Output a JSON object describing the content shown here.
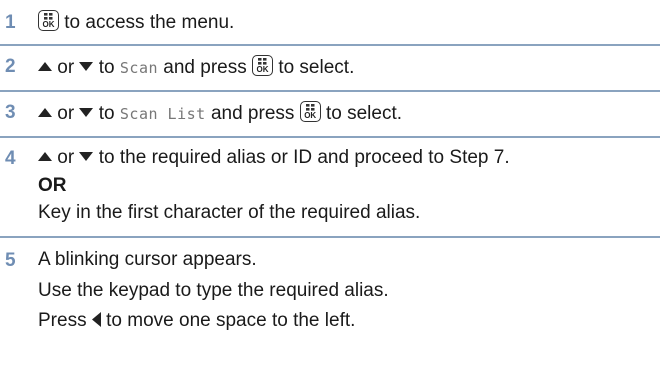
{
  "steps": [
    {
      "number": "1",
      "text_a": "to access the menu."
    },
    {
      "number": "2",
      "or": "or",
      "to": "to",
      "lcd": "Scan",
      "text_b": "and press",
      "text_c": "to select."
    },
    {
      "number": "3",
      "or": "or",
      "to": "to",
      "lcd": "Scan List",
      "text_b": "and press",
      "text_c": "to select."
    },
    {
      "number": "4",
      "or": "or",
      "text_a": "to the required alias or ID and proceed to Step 7.",
      "or_label": "OR",
      "text_b": "Key in the first character of the required alias."
    },
    {
      "number": "5",
      "line1": "A blinking cursor appears.",
      "line2": "Use the keypad to type the required alias.",
      "press": "Press",
      "line3": "to move one space to the left."
    }
  ],
  "icons": {
    "ok_key_label": "OK",
    "up_arrow": "up-arrow-icon",
    "down_arrow": "down-arrow-icon",
    "left_arrow": "left-arrow-icon"
  },
  "colors": {
    "step_number": "#6f8db3",
    "divider": "#8aa3bf",
    "lcd_text": "#777777"
  }
}
